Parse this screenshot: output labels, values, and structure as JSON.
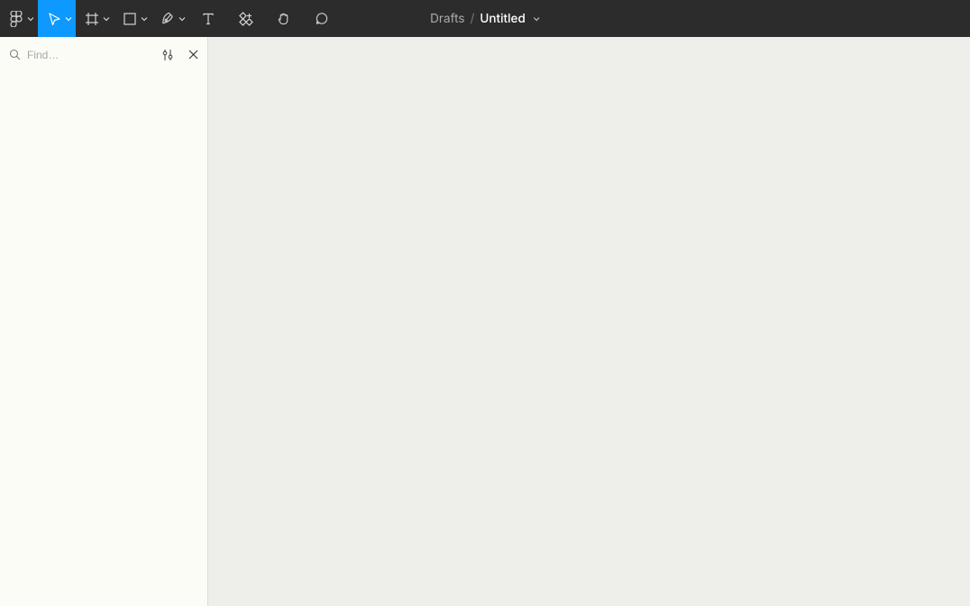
{
  "breadcrumb": {
    "drafts": "Drafts",
    "separator": "/",
    "title": "Untitled"
  },
  "search": {
    "placeholder": "Find…"
  },
  "tools": {
    "logo": "figma-logo-icon",
    "move": "move-tool-icon",
    "frame": "frame-tool-icon",
    "shape": "rectangle-tool-icon",
    "pen": "pen-tool-icon",
    "text": "text-tool-icon",
    "resources": "resources-tool-icon",
    "hand": "hand-tool-icon",
    "comment": "comment-tool-icon"
  }
}
